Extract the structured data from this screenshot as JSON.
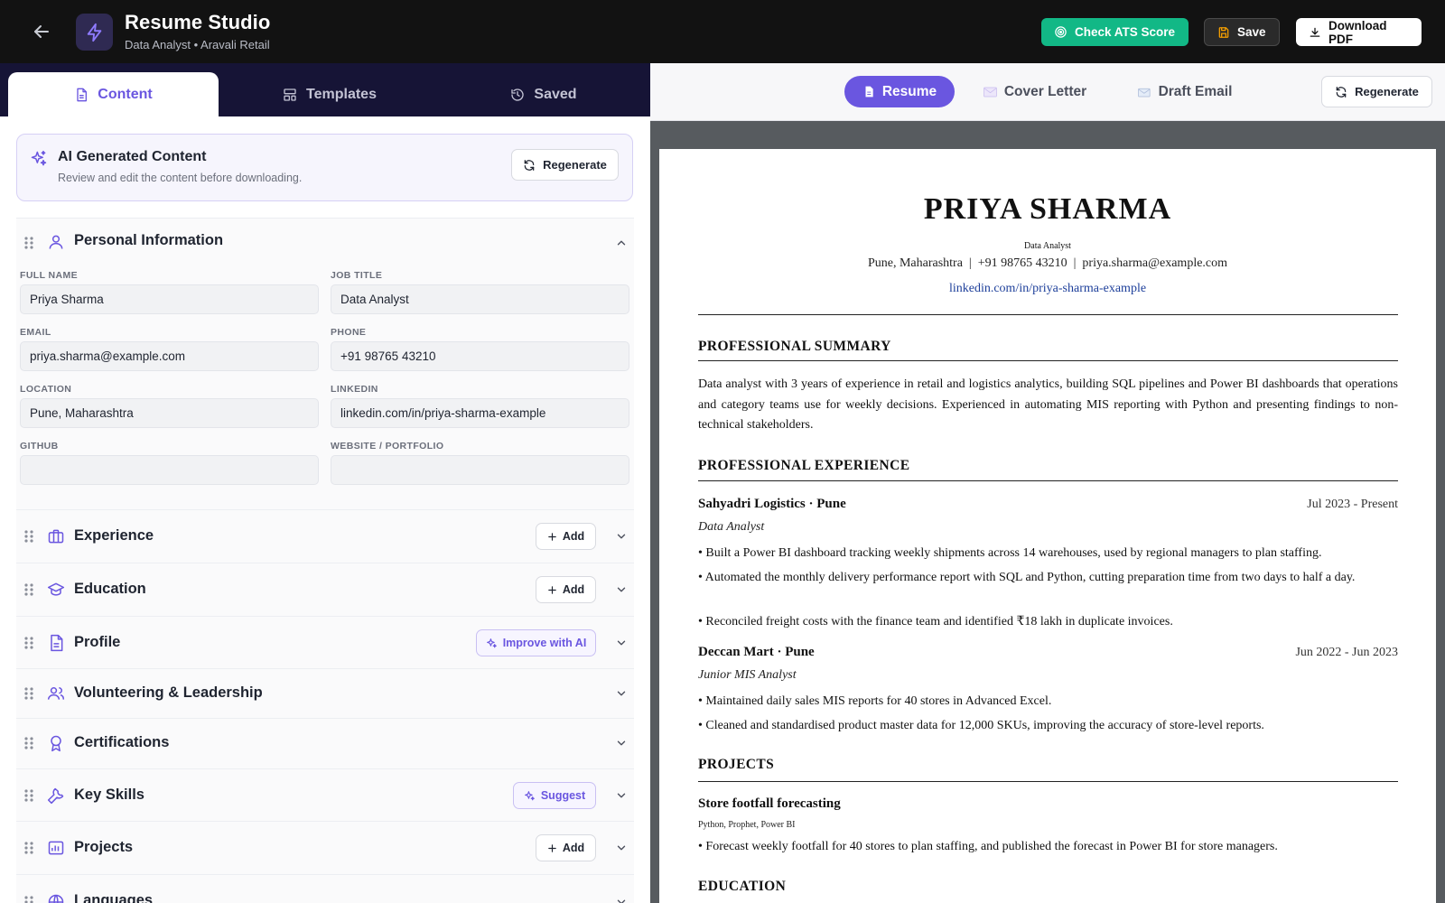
{
  "header": {
    "title": "Resume Studio",
    "subtitle": "Data Analyst • Aravali Retail",
    "ats_label": "Check ATS Score",
    "save_label": "Save",
    "download_label": "Download PDF"
  },
  "tabs": [
    {
      "label": "Content",
      "icon": "document-icon",
      "active": true
    },
    {
      "label": "Templates",
      "icon": "layout-icon",
      "active": false
    },
    {
      "label": "Saved",
      "icon": "history-icon",
      "active": false
    }
  ],
  "ai_card": {
    "title": "AI Generated Content",
    "subtitle": "Review and edit the content before downloading.",
    "regenerate_label": "Regenerate"
  },
  "personal": {
    "title": "Personal Information",
    "fields": {
      "full_name": {
        "label": "FULL NAME",
        "value": "Priya Sharma"
      },
      "job_title": {
        "label": "JOB TITLE",
        "value": "Data Analyst"
      },
      "email": {
        "label": "EMAIL",
        "value": "priya.sharma@example.com"
      },
      "phone": {
        "label": "PHONE",
        "value": "+91 98765 43210"
      },
      "location": {
        "label": "LOCATION",
        "value": "Pune, Maharashtra"
      },
      "linkedin": {
        "label": "LINKEDIN",
        "value": "linkedin.com/in/priya-sharma-example"
      },
      "github": {
        "label": "GITHUB",
        "value": ""
      },
      "website": {
        "label": "WEBSITE / PORTFOLIO",
        "value": ""
      }
    }
  },
  "sections": [
    {
      "title": "Experience",
      "action": "Add"
    },
    {
      "title": "Education",
      "action": "Add"
    },
    {
      "title": "Profile",
      "action": "Improve with AI"
    },
    {
      "title": "Volunteering & Leadership",
      "action": ""
    },
    {
      "title": "Certifications",
      "action": ""
    },
    {
      "title": "Key Skills",
      "action": "Suggest"
    },
    {
      "title": "Projects",
      "action": "Add"
    },
    {
      "title": "Languages",
      "action": ""
    }
  ],
  "preview_tabs": [
    {
      "label": "Resume",
      "active": true
    },
    {
      "label": "Cover Letter",
      "active": false
    },
    {
      "label": "Draft Email",
      "active": false
    }
  ],
  "preview_regenerate_label": "Regenerate",
  "resume": {
    "name": "PRIYA SHARMA",
    "title": "Data Analyst",
    "contact": "Pune, Maharashtra  |  +91 98765 43210  |  priya.sharma@example.com",
    "linkedin": "linkedin.com/in/priya-sharma-example",
    "summary_heading": "PROFESSIONAL SUMMARY",
    "summary": "Data analyst with 3 years of experience in retail and logistics analytics, building SQL pipelines and Power BI dashboards that operations and category teams use for weekly decisions. Experienced in automating MIS reporting with Python and presenting findings to non-technical stakeholders.",
    "experience_heading": "PROFESSIONAL EXPERIENCE",
    "jobs": [
      {
        "org": "Sahyadri Logistics · Pune",
        "dates": "Jul 2023 - Present",
        "role": "Data Analyst",
        "bullets": [
          "• Built a Power BI dashboard tracking weekly shipments across 14 warehouses, used by regional managers to plan staffing.",
          "• Automated the monthly delivery performance report with SQL and Python, cutting preparation time from two days to half a day.",
          "• Reconciled freight costs with the finance team and identified ₹18 lakh in duplicate invoices."
        ]
      },
      {
        "org": "Deccan Mart · Pune",
        "dates": "Jun 2022 - Jun 2023",
        "role": "Junior MIS Analyst",
        "bullets": [
          "• Maintained daily sales MIS reports for 40 stores in Advanced Excel.",
          "• Cleaned and standardised product master data for 12,000 SKUs, improving the accuracy of store-level reports."
        ]
      }
    ],
    "projects_heading": "PROJECTS",
    "project": {
      "title": "Store footfall forecasting",
      "tech": "Python, Prophet, Power BI",
      "bullet": "• Forecast weekly footfall for 40 stores to plan staffing, and published the forecast in Power BI for store managers."
    },
    "education_heading": "EDUCATION"
  },
  "colors": {
    "accent": "#6a56e0",
    "ats_green": "#12b886",
    "topbar": "#121212",
    "tabbar": "#161436",
    "link": "#1d3f9a"
  }
}
